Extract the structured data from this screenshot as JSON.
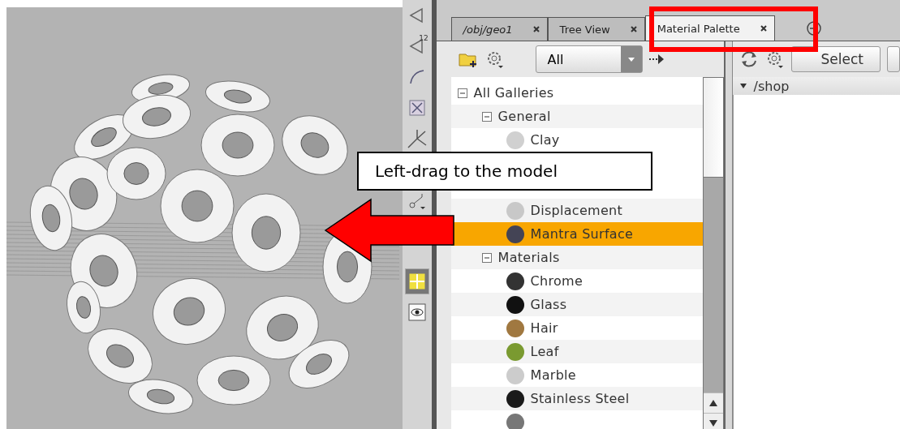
{
  "viewer_tools": [
    {
      "kind": "polygon",
      "selected": false
    },
    {
      "kind": "polygon",
      "label": "12",
      "selected": false
    },
    {
      "kind": "curve",
      "selected": false
    },
    {
      "kind": "expand",
      "selected": false
    },
    {
      "kind": "handle",
      "selected": false
    },
    {
      "kind": "snap",
      "selected": false
    },
    {
      "kind": "grid",
      "selected": true
    },
    {
      "kind": "eye",
      "selected": false
    }
  ],
  "tabs": [
    {
      "label": "/obj/geo1",
      "italic": true,
      "selected": false
    },
    {
      "label": "Tree View",
      "italic": false,
      "selected": false
    },
    {
      "label": "Material Palette",
      "italic": false,
      "selected": true
    }
  ],
  "gallery_toolbar": {
    "filter": "All"
  },
  "gallery_tree": [
    {
      "label": "All Galleries",
      "expanded": true,
      "children": [
        {
          "label": "General",
          "expanded": true,
          "children": [
            {
              "kind": "material",
              "label": "Clay",
              "color": "#d0d0d0",
              "selected": false
            },
            {
              "kind": "covered"
            },
            {
              "kind": "covered"
            },
            {
              "kind": "material",
              "label": "Displacement",
              "color": "#c8c8c8",
              "selected": false
            },
            {
              "kind": "material",
              "label": "Mantra Surface",
              "color": "#444455",
              "selected": true
            }
          ]
        },
        {
          "label": "Materials",
          "expanded": true,
          "children": [
            {
              "kind": "material",
              "label": "Chrome",
              "color": "#333333",
              "selected": false
            },
            {
              "kind": "material",
              "label": "Glass",
              "color": "#111111",
              "selected": false
            },
            {
              "kind": "material",
              "label": "Hair",
              "color": "#a07840",
              "selected": false
            },
            {
              "kind": "material",
              "label": "Leaf",
              "color": "#7a9a30",
              "selected": false
            },
            {
              "kind": "material",
              "label": "Marble",
              "color": "#cccccc",
              "selected": false
            },
            {
              "kind": "material",
              "label": "Stainless Steel",
              "color": "#1a1a1a",
              "selected": false
            },
            {
              "kind": "material",
              "color": "#777777"
            }
          ]
        }
      ]
    }
  ],
  "material_toolbar": {
    "button": "Select"
  },
  "network": {
    "path": "/shop",
    "expanded": true
  },
  "annotations": {
    "callout": "Left-drag to the model"
  }
}
